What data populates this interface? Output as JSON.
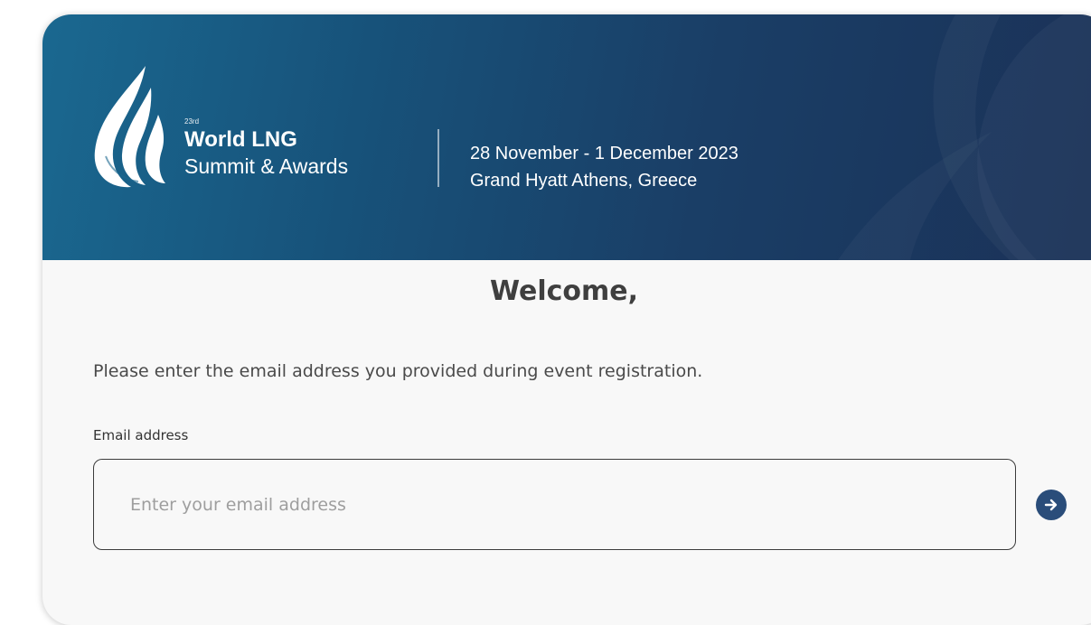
{
  "banner": {
    "edition": "23rd",
    "brand_title": "World LNG",
    "brand_subtitle": "Summit & Awards",
    "event_dates": "28 November - 1 December 2023",
    "event_venue": "Grand Hyatt Athens, Greece"
  },
  "form": {
    "heading": "Welcome,",
    "instructions": "Please enter the email address you provided during event registration.",
    "email_label": "Email address",
    "email_placeholder": "Enter your email address",
    "email_value": "",
    "submit_icon": "arrow-right-icon"
  },
  "colors": {
    "banner_start": "#1a6890",
    "banner_end": "#1b3157",
    "submit_button": "#2a4d7a",
    "heading_text": "#3f3f3f"
  }
}
